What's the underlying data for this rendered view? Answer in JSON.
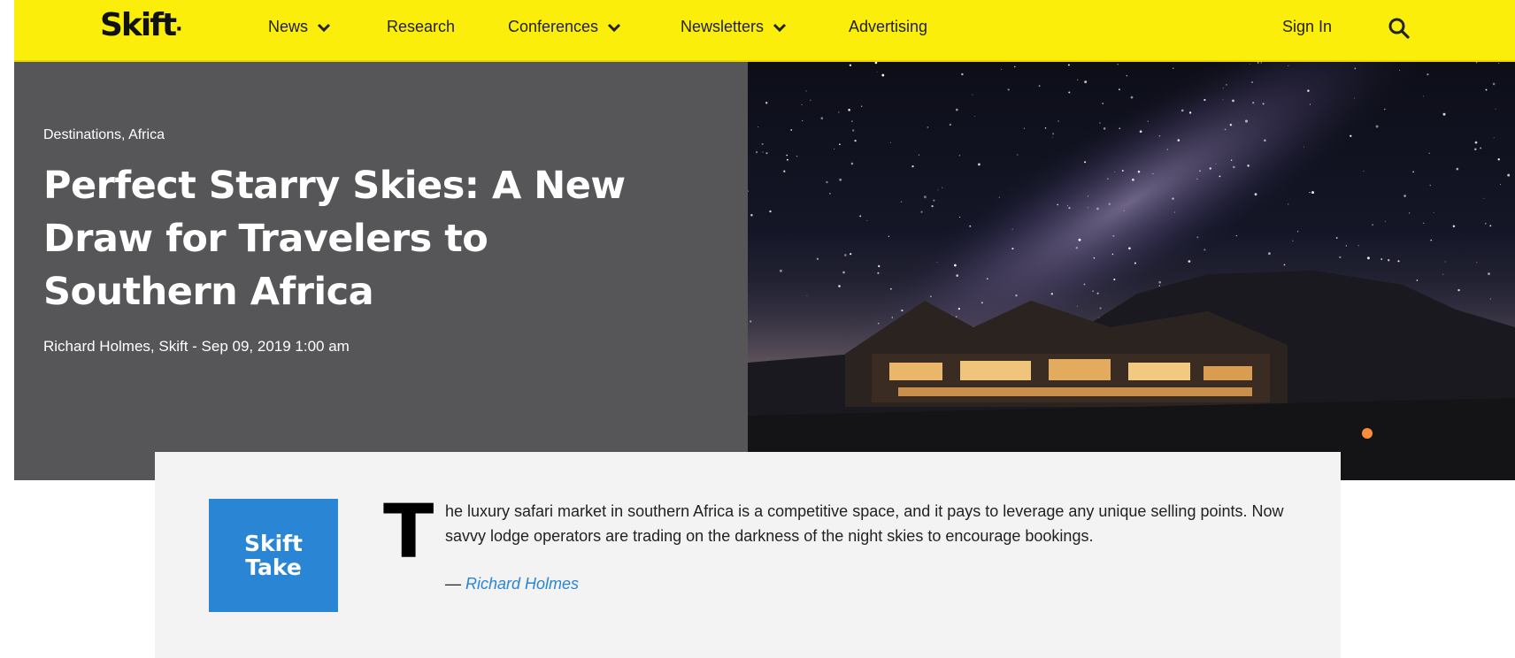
{
  "nav": {
    "logo": "Skift",
    "items": [
      {
        "label": "News",
        "dropdown": true
      },
      {
        "label": "Research",
        "dropdown": false
      },
      {
        "label": "Conferences",
        "dropdown": true
      },
      {
        "label": "Newsletters",
        "dropdown": true
      },
      {
        "label": "Advertising",
        "dropdown": false
      }
    ],
    "sign_in": "Sign In",
    "search_icon": "search-icon",
    "accent_color": "#fbee0b"
  },
  "hero": {
    "categories": [
      "Destinations",
      "Africa"
    ],
    "category_separator": ", ",
    "title": "Perfect Starry Skies: A New Draw for Travelers to Southern Africa",
    "byline": "Richard Holmes, Skift - Sep 09, 2019 1:00 am",
    "image": "night-sky-lodge"
  },
  "skift_take": {
    "badge_line1": "Skift",
    "badge_line2": "Take",
    "dropcap": "T",
    "text": "he luxury safari market in southern Africa is a competitive space, and it pays to leverage any unique selling points. Now savvy lodge operators are trading on the darkness of the night skies to encourage bookings.",
    "author_prefix": "— ",
    "author": "Richard Holmes",
    "badge_color": "#2a85d4"
  }
}
